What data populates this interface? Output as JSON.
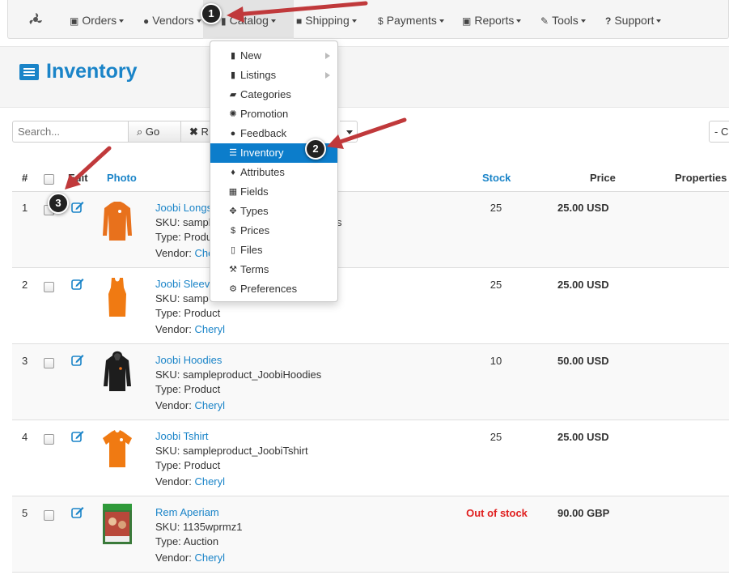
{
  "navbar": {
    "items": [
      {
        "label": "Orders",
        "icon": "money-icon"
      },
      {
        "label": "Vendors",
        "icon": "user-icon"
      },
      {
        "label": "Catalog",
        "icon": "bookmark-icon"
      },
      {
        "label": "Shipping",
        "icon": "truck-icon"
      },
      {
        "label": "Payments",
        "icon": "dollar-icon"
      },
      {
        "label": "Reports",
        "icon": "money-icon"
      },
      {
        "label": "Tools",
        "icon": "wrench-icon"
      },
      {
        "label": "Support",
        "icon": "question-icon"
      }
    ]
  },
  "page": {
    "title": "Inventory"
  },
  "toolbar": {
    "search_placeholder": "Search...",
    "go_label": "Go",
    "reset_label": "R",
    "right_select_label": "- C"
  },
  "table": {
    "headers": {
      "index": "#",
      "edit": "Edit",
      "photo": "Photo",
      "stock": "Stock",
      "price": "Price",
      "properties": "Properties"
    },
    "sku_prefix": "SKU:",
    "type_prefix": "Type:",
    "vendor_prefix": "Vendor:",
    "rows": [
      {
        "index": "1",
        "name": "Joobi Longs",
        "sku": "sampl",
        "sku_tail": "s",
        "type": "Produc",
        "vendor": "Che",
        "stock": "25",
        "price": "25.00 USD"
      },
      {
        "index": "2",
        "name": "Joobi Sleev",
        "sku": "samp",
        "type": "Product",
        "vendor": "Cheryl",
        "stock": "25",
        "price": "25.00 USD"
      },
      {
        "index": "3",
        "name": "Joobi Hoodies",
        "sku": "sampleproduct_JoobiHoodies",
        "type": "Product",
        "vendor": "Cheryl",
        "stock": "10",
        "price": "50.00 USD"
      },
      {
        "index": "4",
        "name": "Joobi Tshirt",
        "sku": "sampleproduct_JoobiTshirt",
        "type": "Product",
        "vendor": "Cheryl",
        "stock": "25",
        "price": "25.00 USD"
      },
      {
        "index": "5",
        "name": "Rem Aperiam",
        "sku": "1135wprmz1",
        "type": "Auction",
        "vendor": "Cheryl",
        "stock": "Out of stock",
        "price": "90.00 GBP"
      }
    ]
  },
  "catalog_menu": {
    "items": [
      {
        "label": "New",
        "icon": "bookmark-icon",
        "submenu": true
      },
      {
        "label": "Listings",
        "icon": "bookmark-icon",
        "submenu": true
      },
      {
        "label": "Categories",
        "icon": "folder-open-icon"
      },
      {
        "label": "Promotion",
        "icon": "rebel-icon"
      },
      {
        "label": "Feedback",
        "icon": "comment-icon"
      },
      {
        "label": "Inventory",
        "icon": "list-alt-icon",
        "active": true
      },
      {
        "label": "Attributes",
        "icon": "map-marker-icon"
      },
      {
        "label": "Fields",
        "icon": "table-icon"
      },
      {
        "label": "Types",
        "icon": "arrows-icon"
      },
      {
        "label": "Prices",
        "icon": "dollar-icon"
      },
      {
        "label": "Files",
        "icon": "file-icon"
      },
      {
        "label": "Terms",
        "icon": "gavel-icon"
      },
      {
        "label": "Preferences",
        "icon": "cogs-icon"
      }
    ]
  },
  "annotations": [
    {
      "label": "1"
    },
    {
      "label": "2"
    },
    {
      "label": "3"
    }
  ],
  "colors": {
    "accent": "#1a84c8",
    "menu_active": "#0c7dcb",
    "out_of_stock": "#e02020",
    "arrow": "#c0393b"
  }
}
